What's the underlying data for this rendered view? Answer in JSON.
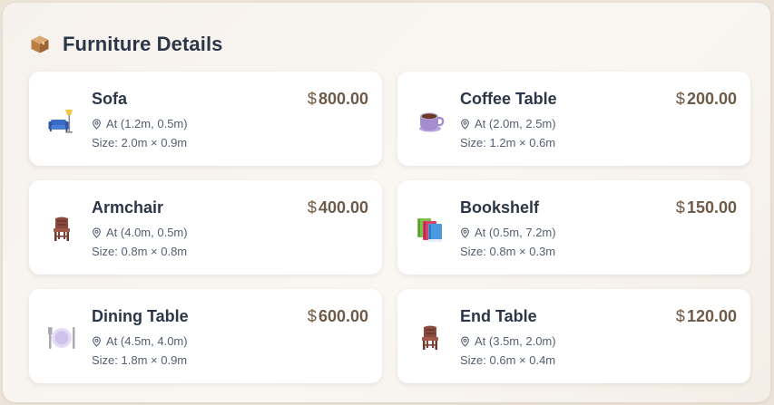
{
  "header": {
    "icon": "package-icon",
    "title": "Furniture Details"
  },
  "items": [
    {
      "name": "Sofa",
      "icon": "sofa-lamp-icon",
      "currency": "$",
      "price": "800.00",
      "location_prefix": "At",
      "location": "At (1.2m, 0.5m)",
      "size": "Size: 2.0m × 0.9m"
    },
    {
      "name": "Coffee Table",
      "icon": "coffee-cup-icon",
      "currency": "$",
      "price": "200.00",
      "location": "At (2.0m, 2.5m)",
      "size": "Size: 1.2m × 0.6m"
    },
    {
      "name": "Armchair",
      "icon": "chair-icon",
      "currency": "$",
      "price": "400.00",
      "location": "At (4.0m, 0.5m)",
      "size": "Size: 0.8m × 0.8m"
    },
    {
      "name": "Bookshelf",
      "icon": "books-icon",
      "currency": "$",
      "price": "150.00",
      "location": "At (0.5m, 7.2m)",
      "size": "Size: 0.8m × 0.3m"
    },
    {
      "name": "Dining Table",
      "icon": "plate-cutlery-icon",
      "currency": "$",
      "price": "600.00",
      "location": "At (4.5m, 4.0m)",
      "size": "Size: 1.8m × 0.9m"
    },
    {
      "name": "End Table",
      "icon": "chair-icon",
      "currency": "$",
      "price": "120.00",
      "location": "At (3.5m, 2.0m)",
      "size": "Size: 0.6m × 0.4m"
    }
  ],
  "colors": {
    "title": "#2b3648",
    "price": "#6d5a48",
    "meta": "#556070",
    "card": "#ffffff",
    "background": "#ece3d9"
  }
}
